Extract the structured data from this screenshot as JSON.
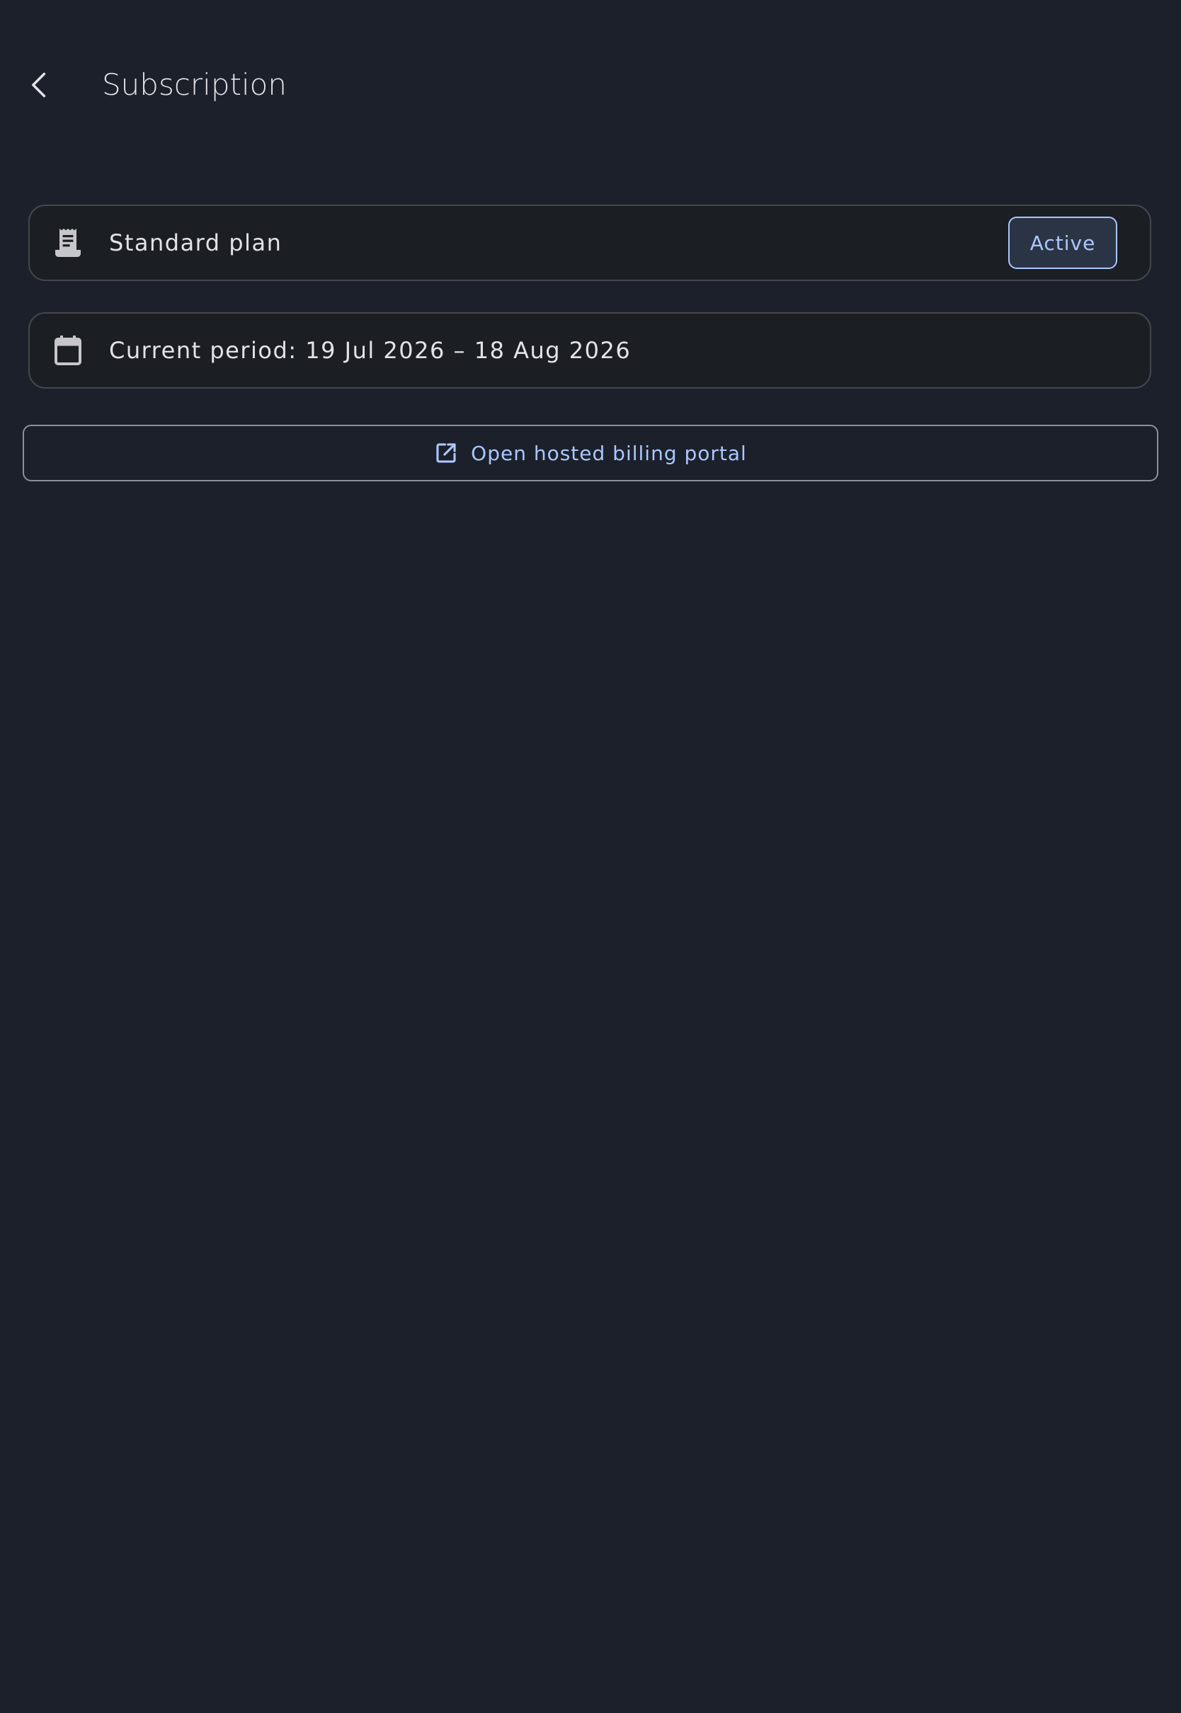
{
  "app_bar": {
    "back_icon": "chevron-left-icon",
    "title": "Subscription"
  },
  "plan_card": {
    "icon": "receipt-icon",
    "label": "Standard plan",
    "status": "Active"
  },
  "period_card": {
    "icon": "calendar-icon",
    "label": "Current period: 19 Jul 2026 – 18 Aug 2026"
  },
  "portal_button": {
    "icon": "open-in-new-icon",
    "label": "Open hosted billing portal"
  },
  "colors": {
    "background": "#1c202a",
    "card_surface": "#1b1e23",
    "outline": "#44474e",
    "accent": "#aac7ff",
    "text": "#e3e2e6"
  }
}
